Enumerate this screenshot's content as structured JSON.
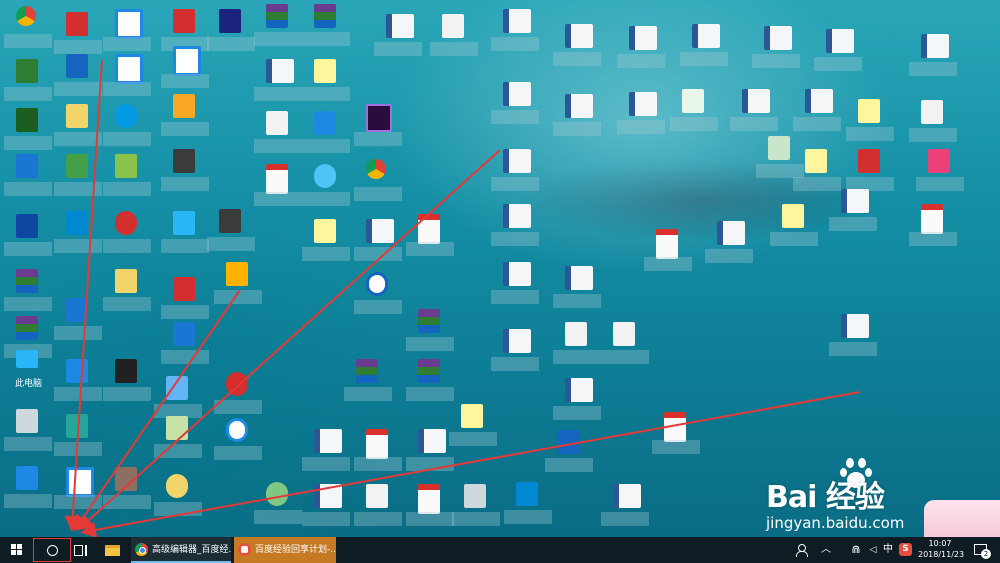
{
  "desktop": {
    "this_pc_label": "此电脑",
    "icons": [
      {
        "kind": "chrome",
        "name": "desktop-shortcut-chrome"
      },
      {
        "kind": "app",
        "name": "desktop-shortcut"
      },
      {
        "kind": "ie",
        "name": "desktop-shortcut-ie"
      },
      {
        "kind": "red",
        "name": "desktop-shortcut-tmall"
      },
      {
        "kind": "app",
        "name": "desktop-shortcut"
      },
      {
        "kind": "rar",
        "name": "desktop-file-archive"
      },
      {
        "kind": "rar",
        "name": "desktop-file-archive"
      },
      {
        "kind": "word",
        "name": "desktop-file-word"
      },
      {
        "kind": "pr",
        "name": "desktop-shortcut-premiere"
      },
      {
        "kind": "pdf",
        "name": "desktop-file-pdf"
      },
      {
        "kind": "file",
        "name": "desktop-file"
      }
    ]
  },
  "watermark": {
    "logo": "Bai 经验",
    "url": "jingyan.baidu.com"
  },
  "taskbar": {
    "start_icon": "windows-logo-icon",
    "search_icon": "search-circle-icon",
    "taskview_icon": "task-view-icon",
    "explorer_icon": "file-explorer-icon",
    "tasks": [
      {
        "label": "高级编辑器_百度经...",
        "icon": "chrome-icon",
        "active": false
      },
      {
        "label": "百度经验回享计划-...",
        "icon": "baidu-jingyan-icon",
        "active": true
      }
    ],
    "tray": {
      "ime": "中",
      "sogou": "S",
      "time": "10:07",
      "date": "2018/11/23",
      "notifications": "2"
    }
  },
  "colors": {
    "arrow": "#e53935",
    "taskbar": "#101c23",
    "active_task": "#c77a24"
  }
}
